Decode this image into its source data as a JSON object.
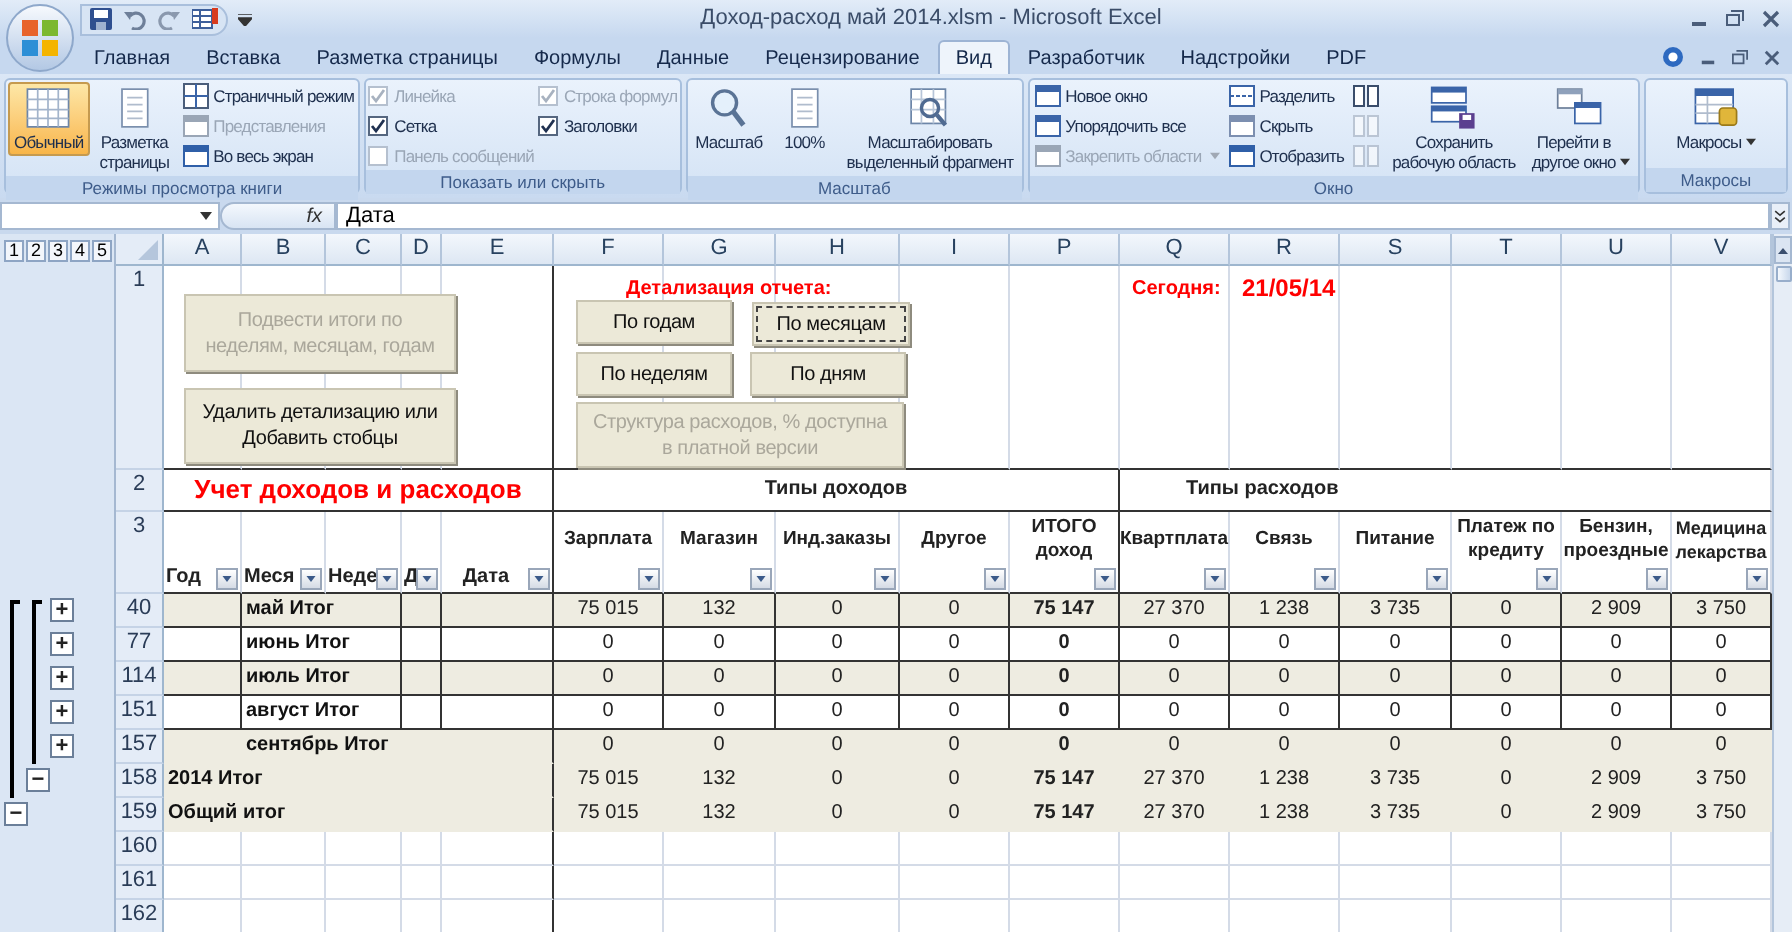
{
  "window": {
    "title": "Доход-расход май 2014.xlsm - Microsoft Excel"
  },
  "ribbon": {
    "tabs": [
      {
        "label": "Главная",
        "selected": false
      },
      {
        "label": "Вставка",
        "selected": false
      },
      {
        "label": "Разметка страницы",
        "selected": false
      },
      {
        "label": "Формулы",
        "selected": false
      },
      {
        "label": "Данные",
        "selected": false
      },
      {
        "label": "Рецензирование",
        "selected": false
      },
      {
        "label": "Вид",
        "selected": true
      },
      {
        "label": "Разработчик",
        "selected": false
      },
      {
        "label": "Надстройки",
        "selected": false
      },
      {
        "label": "PDF",
        "selected": false
      }
    ],
    "groups": [
      {
        "label": "Режимы просмотра книги",
        "columns": [
          [
            {
              "kind": "large",
              "label": "Обычный",
              "selected": true,
              "disabled": false
            }
          ],
          [
            {
              "kind": "large",
              "label": "Разметка\nстраницы",
              "selected": false,
              "disabled": false
            }
          ],
          [
            {
              "kind": "small",
              "label": "Страничный режим",
              "selected": false,
              "disabled": false
            },
            {
              "kind": "small",
              "label": "Представления",
              "selected": false,
              "disabled": true
            },
            {
              "kind": "small",
              "label": "Во весь экран",
              "selected": false,
              "disabled": false
            }
          ]
        ]
      },
      {
        "label": "Показать или скрыть",
        "columns": [
          [
            {
              "kind": "checkbox",
              "label": "Линейка",
              "checked": true,
              "disabled": true
            },
            {
              "kind": "checkbox",
              "label": "Сетка",
              "checked": true,
              "disabled": false
            },
            {
              "kind": "checkbox",
              "label": "Панель сообщений",
              "checked": false,
              "disabled": true
            }
          ],
          [
            {
              "kind": "checkbox",
              "label": "Строка формул",
              "checked": true,
              "disabled": true
            },
            {
              "kind": "checkbox",
              "label": "Заголовки",
              "checked": true,
              "disabled": false
            }
          ]
        ]
      },
      {
        "label": "Масштаб",
        "columns": [
          [
            {
              "kind": "large",
              "label": "Масштаб",
              "selected": false,
              "disabled": false
            }
          ],
          [
            {
              "kind": "large",
              "label": "100%",
              "selected": false,
              "disabled": false
            }
          ],
          [
            {
              "kind": "large",
              "label": "Масштабировать\nвыделенный фрагмент",
              "selected": false,
              "disabled": false
            }
          ]
        ]
      },
      {
        "label": "Окно",
        "columns": [
          [
            {
              "kind": "small",
              "label": "Новое окно",
              "selected": false,
              "disabled": false
            },
            {
              "kind": "small",
              "label": "Упорядочить все",
              "selected": false,
              "disabled": false
            },
            {
              "kind": "small",
              "label": "Закрепить области",
              "selected": false,
              "disabled": true,
              "dropdown": true
            }
          ],
          [
            {
              "kind": "small",
              "label": "Разделить",
              "selected": false,
              "disabled": false
            },
            {
              "kind": "small",
              "label": "Скрыть",
              "selected": false,
              "disabled": false
            },
            {
              "kind": "small",
              "label": "Отобразить",
              "selected": false,
              "disabled": false
            }
          ],
          [
            {
              "kind": "icon",
              "selected": false,
              "disabled": false
            },
            {
              "kind": "icon",
              "selected": false,
              "disabled": true
            },
            {
              "kind": "icon",
              "selected": false,
              "disabled": true
            }
          ],
          [
            {
              "kind": "large",
              "label": "Сохранить\nрабочую область",
              "selected": false,
              "disabled": false
            }
          ],
          [
            {
              "kind": "large",
              "label": "Перейти в\nдругое окно",
              "selected": false,
              "disabled": false,
              "dropdown": true
            }
          ]
        ]
      },
      {
        "label": "Макросы",
        "columns": [
          [
            {
              "kind": "large",
              "label": "Макросы",
              "selected": false,
              "disabled": false,
              "dropdown": true
            }
          ]
        ]
      }
    ]
  },
  "formula_bar": {
    "fx": "fx",
    "formula": "Дата"
  },
  "sheet": {
    "outline_levels": [
      "1",
      "2",
      "3",
      "4",
      "5"
    ],
    "columns": [
      "A",
      "B",
      "C",
      "D",
      "E",
      "F",
      "G",
      "H",
      "I",
      "P",
      "Q",
      "R",
      "S",
      "T",
      "U",
      "V"
    ],
    "header_rows": [
      "1",
      "2",
      "3"
    ],
    "report_label": "Детализация отчета:",
    "buttons": [
      {
        "label": "Подвести итоги по\nнеделям, месяцам, годам",
        "disabled": true,
        "selected": false
      },
      {
        "label": "Удалить детализацию или\nДобавить стобцы",
        "disabled": false,
        "selected": false
      },
      {
        "label": "По годам",
        "disabled": false,
        "selected": false
      },
      {
        "label": "По месяцам",
        "disabled": false,
        "selected": true
      },
      {
        "label": "По неделям",
        "disabled": false,
        "selected": false
      },
      {
        "label": "По дням",
        "disabled": false,
        "selected": false
      },
      {
        "label": "Структура расходов, % доступна\nв платной версии",
        "disabled": true,
        "selected": false
      }
    ],
    "today_label": "Сегодня:",
    "today_value": "21/05/14",
    "title": "Учет доходов и расходов",
    "income_header": "Типы доходов",
    "expense_header": "Типы расходов",
    "headers": [
      "Год",
      "Меся",
      "Неде",
      "Д",
      "Дата",
      "Зарплата",
      "Магазин",
      "Инд.заказы",
      "Другое",
      "ИТОГО\nдоход",
      "Квартплата",
      "Связь",
      "Питание",
      "Платеж по\nкредиту",
      "Бензин,\nпроездные",
      "Медицина\nлекарства"
    ],
    "rows": [
      {
        "number": "40",
        "kind": "month",
        "label": "май Итог",
        "shaded": true,
        "outline_button": "+",
        "values": [
          "75 015",
          "132",
          "0",
          "0",
          "75 147",
          "27 370",
          "1 238",
          "3 735",
          "0",
          "2 909",
          "3 750"
        ]
      },
      {
        "number": "77",
        "kind": "month",
        "label": "июнь Итог",
        "shaded": false,
        "outline_button": "+",
        "values": [
          "0",
          "0",
          "0",
          "0",
          "0",
          "0",
          "0",
          "0",
          "0",
          "0",
          "0"
        ]
      },
      {
        "number": "114",
        "kind": "month",
        "label": "июль Итог",
        "shaded": true,
        "outline_button": "+",
        "values": [
          "0",
          "0",
          "0",
          "0",
          "0",
          "0",
          "0",
          "0",
          "0",
          "0",
          "0"
        ]
      },
      {
        "number": "151",
        "kind": "month",
        "label": "август Итог",
        "shaded": false,
        "outline_button": "+",
        "values": [
          "0",
          "0",
          "0",
          "0",
          "0",
          "0",
          "0",
          "0",
          "0",
          "0",
          "0"
        ]
      },
      {
        "number": "157",
        "kind": "month_merged",
        "label": "сентябрь Итог",
        "shaded": true,
        "outline_button": "+",
        "values": [
          "0",
          "0",
          "0",
          "0",
          "0",
          "0",
          "0",
          "0",
          "0",
          "0",
          "0"
        ]
      },
      {
        "number": "158",
        "kind": "year",
        "label": "2014 Итог",
        "shaded": true,
        "outline_button": "−",
        "values": [
          "75 015",
          "132",
          "0",
          "0",
          "75 147",
          "27 370",
          "1 238",
          "3 735",
          "0",
          "2 909",
          "3 750"
        ]
      },
      {
        "number": "159",
        "kind": "grand",
        "label": "Общий итог",
        "shaded": true,
        "outline_button": "−",
        "values": [
          "75 015",
          "132",
          "0",
          "0",
          "75 147",
          "27 370",
          "1 238",
          "3 735",
          "0",
          "2 909",
          "3 750"
        ]
      },
      {
        "number": "160",
        "kind": "blank"
      },
      {
        "number": "161",
        "kind": "blank"
      },
      {
        "number": "162",
        "kind": "blank"
      }
    ]
  }
}
